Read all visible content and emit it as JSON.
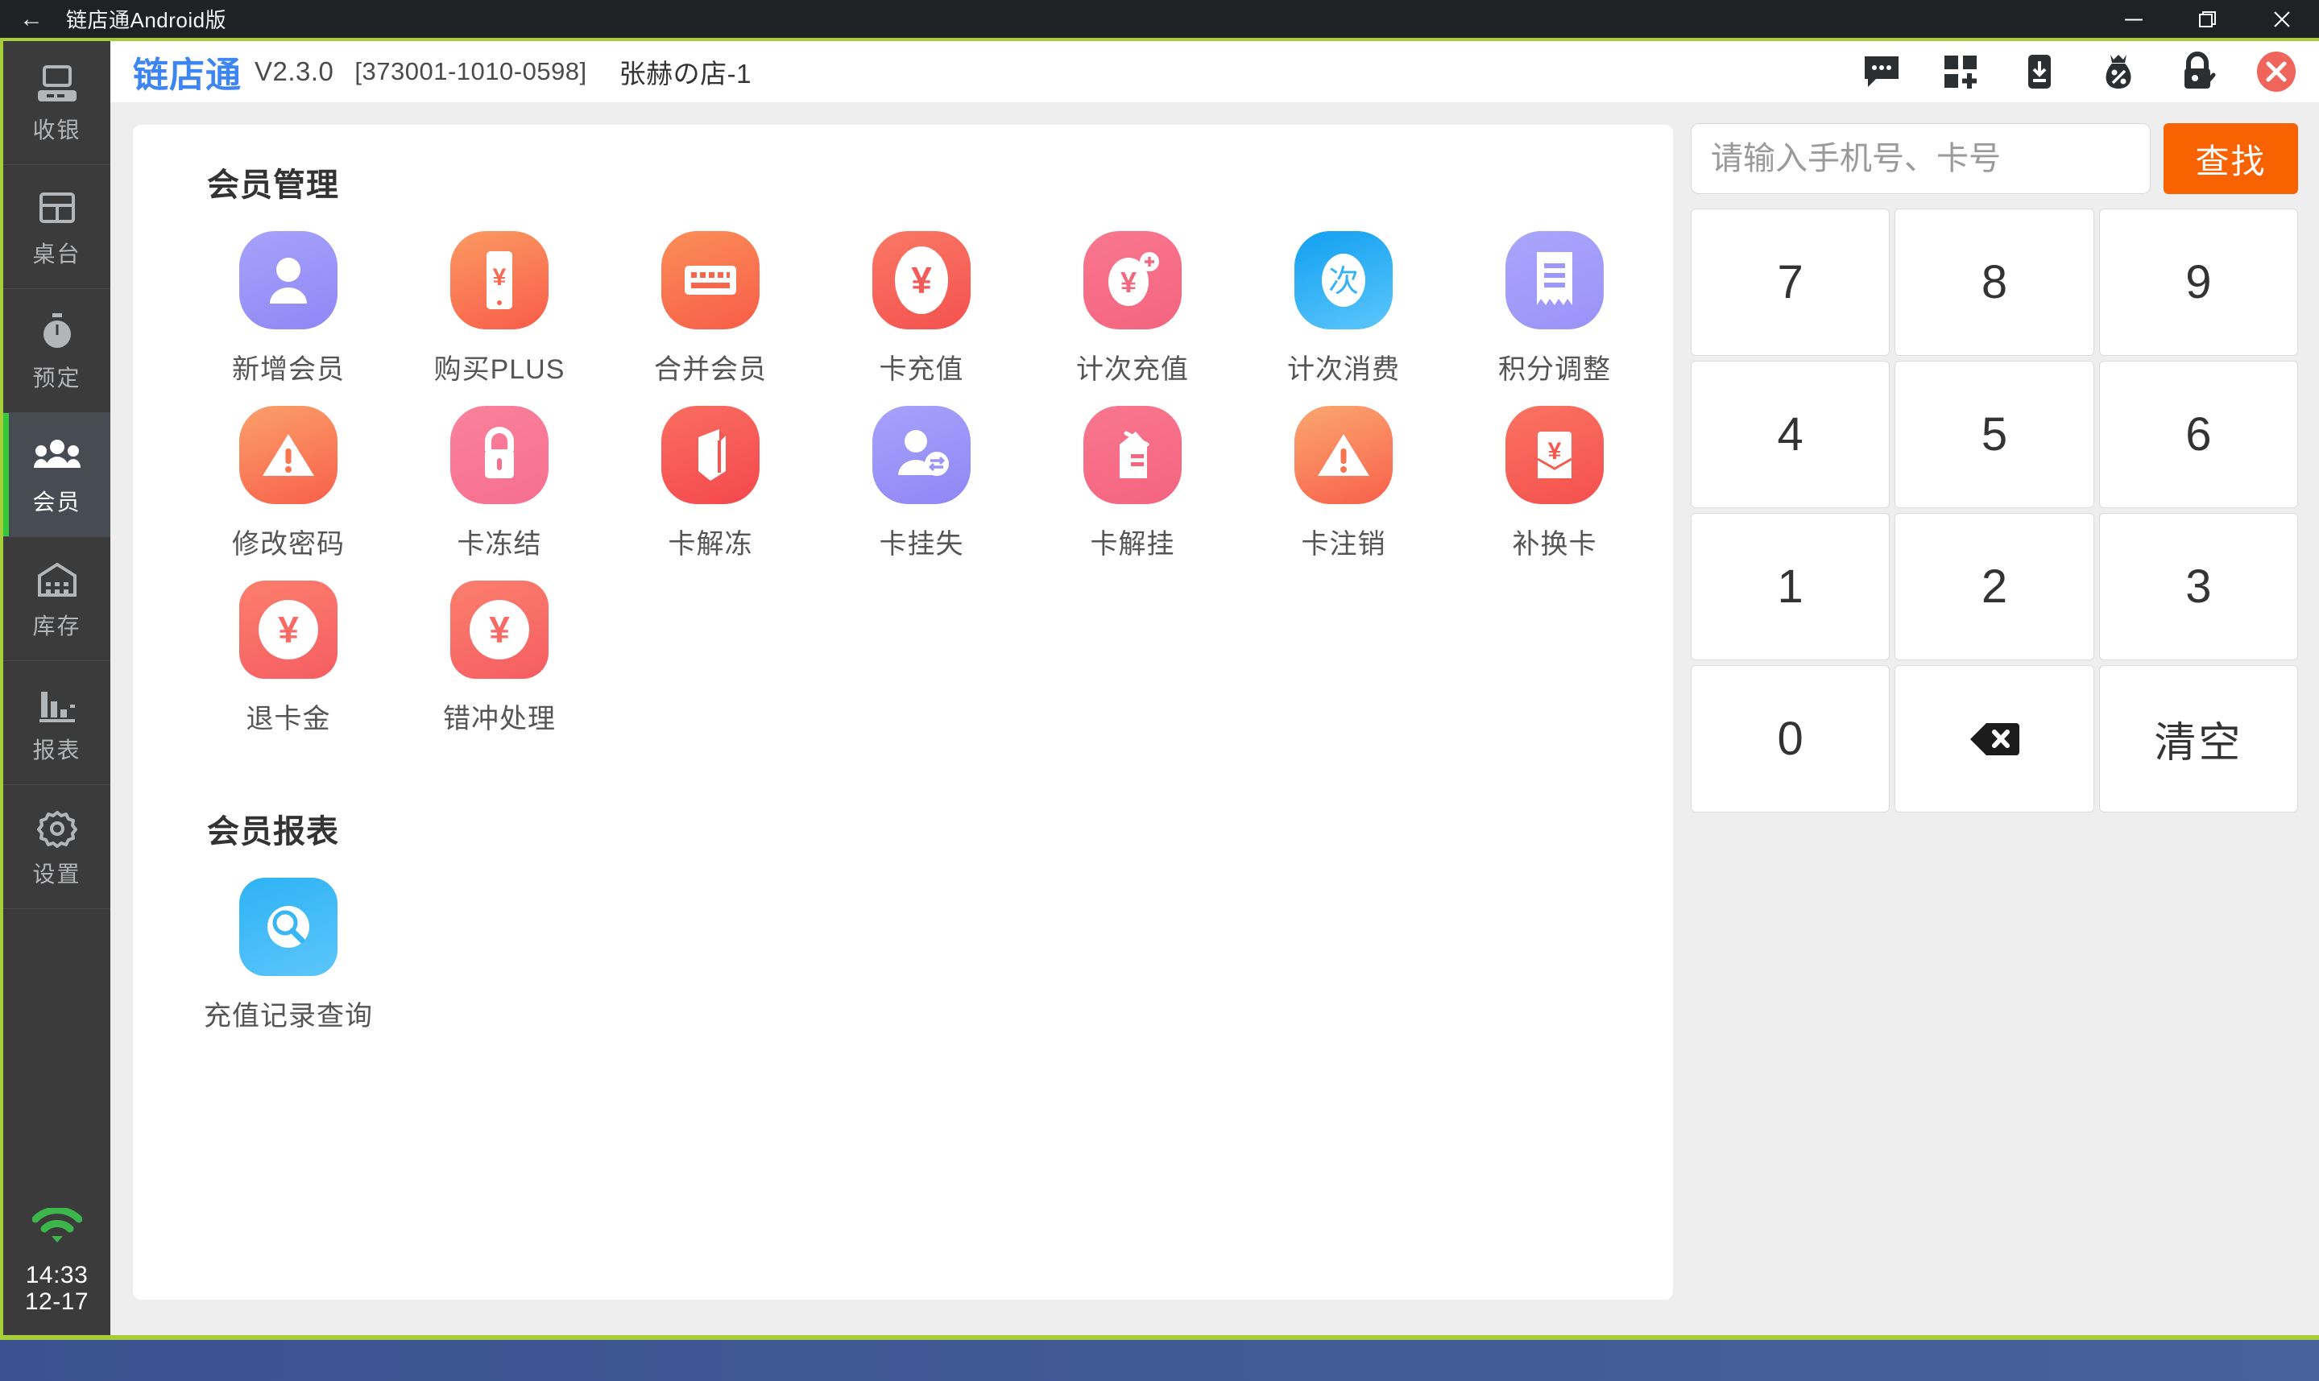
{
  "os_window": {
    "title": "链店通Android版",
    "back_icon": "back-arrow-icon",
    "minimize_icon": "minimize-icon",
    "restore_icon": "restore-window-icon",
    "close_icon": "close-icon"
  },
  "header": {
    "brand": "链店通",
    "version": "V2.3.0",
    "device_code": "[373001-1010-0598]",
    "shop_name": "张赫の店-1",
    "tools": [
      {
        "name": "message-icon",
        "title": "消息"
      },
      {
        "name": "apps-add-icon",
        "title": "应用"
      },
      {
        "name": "download-icon",
        "title": "下载"
      },
      {
        "name": "money-bag-percent-icon",
        "title": "优惠"
      },
      {
        "name": "lock-check-icon",
        "title": "锁屏"
      },
      {
        "name": "close-circle-icon",
        "title": "关闭"
      }
    ],
    "brand_color": "#3d85f2",
    "close_color": "#f0655b"
  },
  "sidebar": {
    "items": [
      {
        "label": "收银",
        "icon": "cash-register-icon",
        "active": false
      },
      {
        "label": "桌台",
        "icon": "table-grid-icon",
        "active": false
      },
      {
        "label": "预定",
        "icon": "stopwatch-icon",
        "active": false
      },
      {
        "label": "会员",
        "icon": "members-icon",
        "active": true
      },
      {
        "label": "库存",
        "icon": "warehouse-icon",
        "active": false
      },
      {
        "label": "报表",
        "icon": "bar-chart-icon",
        "active": false
      },
      {
        "label": "设置",
        "icon": "gear-icon",
        "active": false
      }
    ],
    "status": {
      "wifi_icon": "wifi-icon",
      "wifi_color": "#3cb54a",
      "time": "14:33",
      "date": "12-17"
    },
    "active_indicator_color": "#36c93c"
  },
  "main": {
    "sections": [
      {
        "title": "会员管理",
        "tiles": [
          {
            "label": "新增会员",
            "icon": "user-add-icon",
            "shape": "pill",
            "c1": "#a6a2fa",
            "c2": "#8f87f6"
          },
          {
            "label": "购买PLUS",
            "icon": "phone-yen-icon",
            "shape": "pill",
            "c1": "#fb9a61",
            "c2": "#f95c4a"
          },
          {
            "label": "合并会员",
            "icon": "merge-card-icon",
            "shape": "pill",
            "c1": "#fb8e58",
            "c2": "#f75d48"
          },
          {
            "label": "卡充值",
            "icon": "yen-recharge-icon",
            "shape": "pill",
            "c1": "#fa7865",
            "c2": "#f4514f"
          },
          {
            "label": "计次充值",
            "icon": "yen-plus-icon",
            "shape": "pill",
            "c1": "#f9778f",
            "c2": "#f4647f"
          },
          {
            "label": "计次消费",
            "icon": "times-consume-icon",
            "shape": "pill",
            "c1": "#119ff0",
            "c2": "#5cc6fb"
          },
          {
            "label": "积分调整",
            "icon": "receipt-icon",
            "shape": "pill",
            "c1": "#a9a5fb",
            "c2": "#9a93f8"
          },
          {
            "label": "修改密码",
            "icon": "warning-icon",
            "shape": "pill",
            "c1": "#fba06a",
            "c2": "#f8604a"
          },
          {
            "label": "卡冻结",
            "icon": "lock-icon",
            "shape": "pill",
            "c1": "#f9819b",
            "c2": "#f76f90"
          },
          {
            "label": "卡解冻",
            "icon": "unfreeze-card-icon",
            "shape": "pill",
            "c1": "#fa6d60",
            "c2": "#f4484e"
          },
          {
            "label": "卡挂失",
            "icon": "user-report-lost-icon",
            "shape": "pill",
            "c1": "#a6a2fa",
            "c2": "#8f87f6"
          },
          {
            "label": "卡解挂",
            "icon": "card-unlock-icon",
            "shape": "pill",
            "c1": "#f9778f",
            "c2": "#f4647f"
          },
          {
            "label": "卡注销",
            "icon": "warning-icon",
            "shape": "pill",
            "c1": "#fba76f",
            "c2": "#f8604a"
          },
          {
            "label": "补换卡",
            "icon": "replace-card-yen-icon",
            "shape": "pill",
            "c1": "#fa7361",
            "c2": "#f4504e"
          },
          {
            "label": "退卡金",
            "icon": "yen-refund-icon",
            "shape": "square",
            "c1": "#fb7f6d",
            "c2": "#f65d62"
          },
          {
            "label": "错冲处理",
            "icon": "yen-correction-icon",
            "shape": "square",
            "c1": "#fb7f6d",
            "c2": "#f65d62"
          }
        ]
      },
      {
        "title": "会员报表",
        "tiles": [
          {
            "label": "充值记录查询",
            "icon": "search-record-icon",
            "shape": "square",
            "c1": "#2db2f4",
            "c2": "#5cc6fb"
          }
        ]
      }
    ]
  },
  "search": {
    "placeholder": "请输入手机号、卡号",
    "value": "",
    "button_label": "查找",
    "button_color": "#f86200"
  },
  "keypad": {
    "keys": [
      {
        "label": "7",
        "name": "key-7",
        "type": "digit"
      },
      {
        "label": "8",
        "name": "key-8",
        "type": "digit"
      },
      {
        "label": "9",
        "name": "key-9",
        "type": "digit"
      },
      {
        "label": "4",
        "name": "key-4",
        "type": "digit"
      },
      {
        "label": "5",
        "name": "key-5",
        "type": "digit"
      },
      {
        "label": "6",
        "name": "key-6",
        "type": "digit"
      },
      {
        "label": "1",
        "name": "key-1",
        "type": "digit"
      },
      {
        "label": "2",
        "name": "key-2",
        "type": "digit"
      },
      {
        "label": "3",
        "name": "key-3",
        "type": "digit"
      },
      {
        "label": "0",
        "name": "key-0",
        "type": "digit"
      },
      {
        "label": "",
        "name": "key-backspace",
        "type": "backspace"
      },
      {
        "label": "清空",
        "name": "key-clear",
        "type": "text"
      }
    ]
  }
}
